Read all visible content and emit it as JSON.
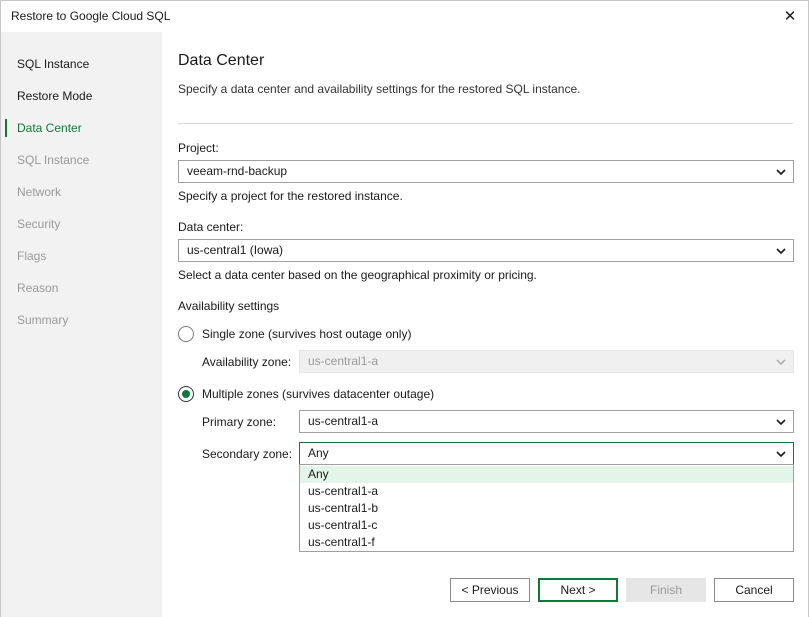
{
  "window": {
    "title": "Restore to Google Cloud SQL",
    "close_glyph": "✕"
  },
  "sidebar": {
    "items": [
      {
        "label": "SQL Instance",
        "state": "done"
      },
      {
        "label": "Restore Mode",
        "state": "done"
      },
      {
        "label": "Data Center",
        "state": "active"
      },
      {
        "label": "SQL Instance",
        "state": "pending"
      },
      {
        "label": "Network",
        "state": "pending"
      },
      {
        "label": "Security",
        "state": "pending"
      },
      {
        "label": "Flags",
        "state": "pending"
      },
      {
        "label": "Reason",
        "state": "pending"
      },
      {
        "label": "Summary",
        "state": "pending"
      }
    ]
  },
  "main": {
    "title": "Data Center",
    "description": "Specify a data center and availability settings for the restored SQL instance.",
    "project": {
      "label": "Project:",
      "value": "veeam-rnd-backup",
      "hint": "Specify a project for the restored instance."
    },
    "data_center": {
      "label": "Data center:",
      "value": "us-central1 (Iowa)",
      "hint": "Select a data center based on the geographical proximity or pricing."
    },
    "availability": {
      "heading": "Availability settings",
      "single_zone": {
        "label": "Single zone (survives host outage only)",
        "checked": false,
        "zone_label": "Availability zone:",
        "zone_value": "us-central1-a"
      },
      "multiple_zones": {
        "label": "Multiple zones (survives datacenter outage)",
        "checked": true,
        "primary_label": "Primary zone:",
        "primary_value": "us-central1-a",
        "secondary_label": "Secondary zone:",
        "secondary_value": "Any",
        "secondary_options": [
          "Any",
          "us-central1-a",
          "us-central1-b",
          "us-central1-c",
          "us-central1-f"
        ],
        "highlighted_option": "Any"
      }
    }
  },
  "footer": {
    "previous_label": "< Previous",
    "next_label": "Next >",
    "finish_label": "Finish",
    "cancel_label": "Cancel"
  },
  "colors": {
    "accent": "#0e7a3a",
    "sidebar_bg": "#f2f2f2",
    "option_highlight": "#e3f4e8"
  }
}
